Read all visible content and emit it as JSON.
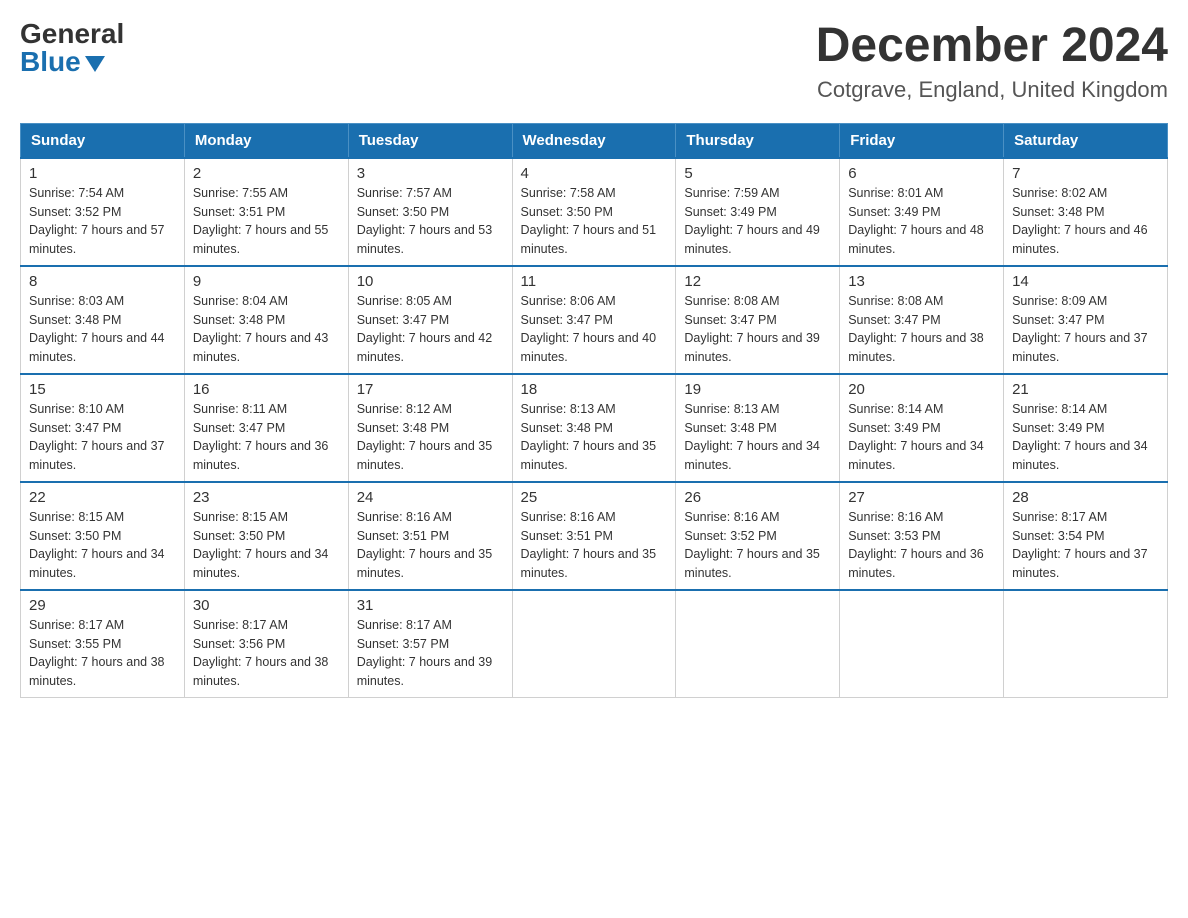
{
  "header": {
    "logo_general": "General",
    "logo_blue": "Blue",
    "title": "December 2024",
    "subtitle": "Cotgrave, England, United Kingdom"
  },
  "calendar": {
    "days_of_week": [
      "Sunday",
      "Monday",
      "Tuesday",
      "Wednesday",
      "Thursday",
      "Friday",
      "Saturday"
    ],
    "weeks": [
      [
        {
          "day": "1",
          "sunrise": "7:54 AM",
          "sunset": "3:52 PM",
          "daylight": "7 hours and 57 minutes."
        },
        {
          "day": "2",
          "sunrise": "7:55 AM",
          "sunset": "3:51 PM",
          "daylight": "7 hours and 55 minutes."
        },
        {
          "day": "3",
          "sunrise": "7:57 AM",
          "sunset": "3:50 PM",
          "daylight": "7 hours and 53 minutes."
        },
        {
          "day": "4",
          "sunrise": "7:58 AM",
          "sunset": "3:50 PM",
          "daylight": "7 hours and 51 minutes."
        },
        {
          "day": "5",
          "sunrise": "7:59 AM",
          "sunset": "3:49 PM",
          "daylight": "7 hours and 49 minutes."
        },
        {
          "day": "6",
          "sunrise": "8:01 AM",
          "sunset": "3:49 PM",
          "daylight": "7 hours and 48 minutes."
        },
        {
          "day": "7",
          "sunrise": "8:02 AM",
          "sunset": "3:48 PM",
          "daylight": "7 hours and 46 minutes."
        }
      ],
      [
        {
          "day": "8",
          "sunrise": "8:03 AM",
          "sunset": "3:48 PM",
          "daylight": "7 hours and 44 minutes."
        },
        {
          "day": "9",
          "sunrise": "8:04 AM",
          "sunset": "3:48 PM",
          "daylight": "7 hours and 43 minutes."
        },
        {
          "day": "10",
          "sunrise": "8:05 AM",
          "sunset": "3:47 PM",
          "daylight": "7 hours and 42 minutes."
        },
        {
          "day": "11",
          "sunrise": "8:06 AM",
          "sunset": "3:47 PM",
          "daylight": "7 hours and 40 minutes."
        },
        {
          "day": "12",
          "sunrise": "8:08 AM",
          "sunset": "3:47 PM",
          "daylight": "7 hours and 39 minutes."
        },
        {
          "day": "13",
          "sunrise": "8:08 AM",
          "sunset": "3:47 PM",
          "daylight": "7 hours and 38 minutes."
        },
        {
          "day": "14",
          "sunrise": "8:09 AM",
          "sunset": "3:47 PM",
          "daylight": "7 hours and 37 minutes."
        }
      ],
      [
        {
          "day": "15",
          "sunrise": "8:10 AM",
          "sunset": "3:47 PM",
          "daylight": "7 hours and 37 minutes."
        },
        {
          "day": "16",
          "sunrise": "8:11 AM",
          "sunset": "3:47 PM",
          "daylight": "7 hours and 36 minutes."
        },
        {
          "day": "17",
          "sunrise": "8:12 AM",
          "sunset": "3:48 PM",
          "daylight": "7 hours and 35 minutes."
        },
        {
          "day": "18",
          "sunrise": "8:13 AM",
          "sunset": "3:48 PM",
          "daylight": "7 hours and 35 minutes."
        },
        {
          "day": "19",
          "sunrise": "8:13 AM",
          "sunset": "3:48 PM",
          "daylight": "7 hours and 34 minutes."
        },
        {
          "day": "20",
          "sunrise": "8:14 AM",
          "sunset": "3:49 PM",
          "daylight": "7 hours and 34 minutes."
        },
        {
          "day": "21",
          "sunrise": "8:14 AM",
          "sunset": "3:49 PM",
          "daylight": "7 hours and 34 minutes."
        }
      ],
      [
        {
          "day": "22",
          "sunrise": "8:15 AM",
          "sunset": "3:50 PM",
          "daylight": "7 hours and 34 minutes."
        },
        {
          "day": "23",
          "sunrise": "8:15 AM",
          "sunset": "3:50 PM",
          "daylight": "7 hours and 34 minutes."
        },
        {
          "day": "24",
          "sunrise": "8:16 AM",
          "sunset": "3:51 PM",
          "daylight": "7 hours and 35 minutes."
        },
        {
          "day": "25",
          "sunrise": "8:16 AM",
          "sunset": "3:51 PM",
          "daylight": "7 hours and 35 minutes."
        },
        {
          "day": "26",
          "sunrise": "8:16 AM",
          "sunset": "3:52 PM",
          "daylight": "7 hours and 35 minutes."
        },
        {
          "day": "27",
          "sunrise": "8:16 AM",
          "sunset": "3:53 PM",
          "daylight": "7 hours and 36 minutes."
        },
        {
          "day": "28",
          "sunrise": "8:17 AM",
          "sunset": "3:54 PM",
          "daylight": "7 hours and 37 minutes."
        }
      ],
      [
        {
          "day": "29",
          "sunrise": "8:17 AM",
          "sunset": "3:55 PM",
          "daylight": "7 hours and 38 minutes."
        },
        {
          "day": "30",
          "sunrise": "8:17 AM",
          "sunset": "3:56 PM",
          "daylight": "7 hours and 38 minutes."
        },
        {
          "day": "31",
          "sunrise": "8:17 AM",
          "sunset": "3:57 PM",
          "daylight": "7 hours and 39 minutes."
        },
        null,
        null,
        null,
        null
      ]
    ]
  }
}
